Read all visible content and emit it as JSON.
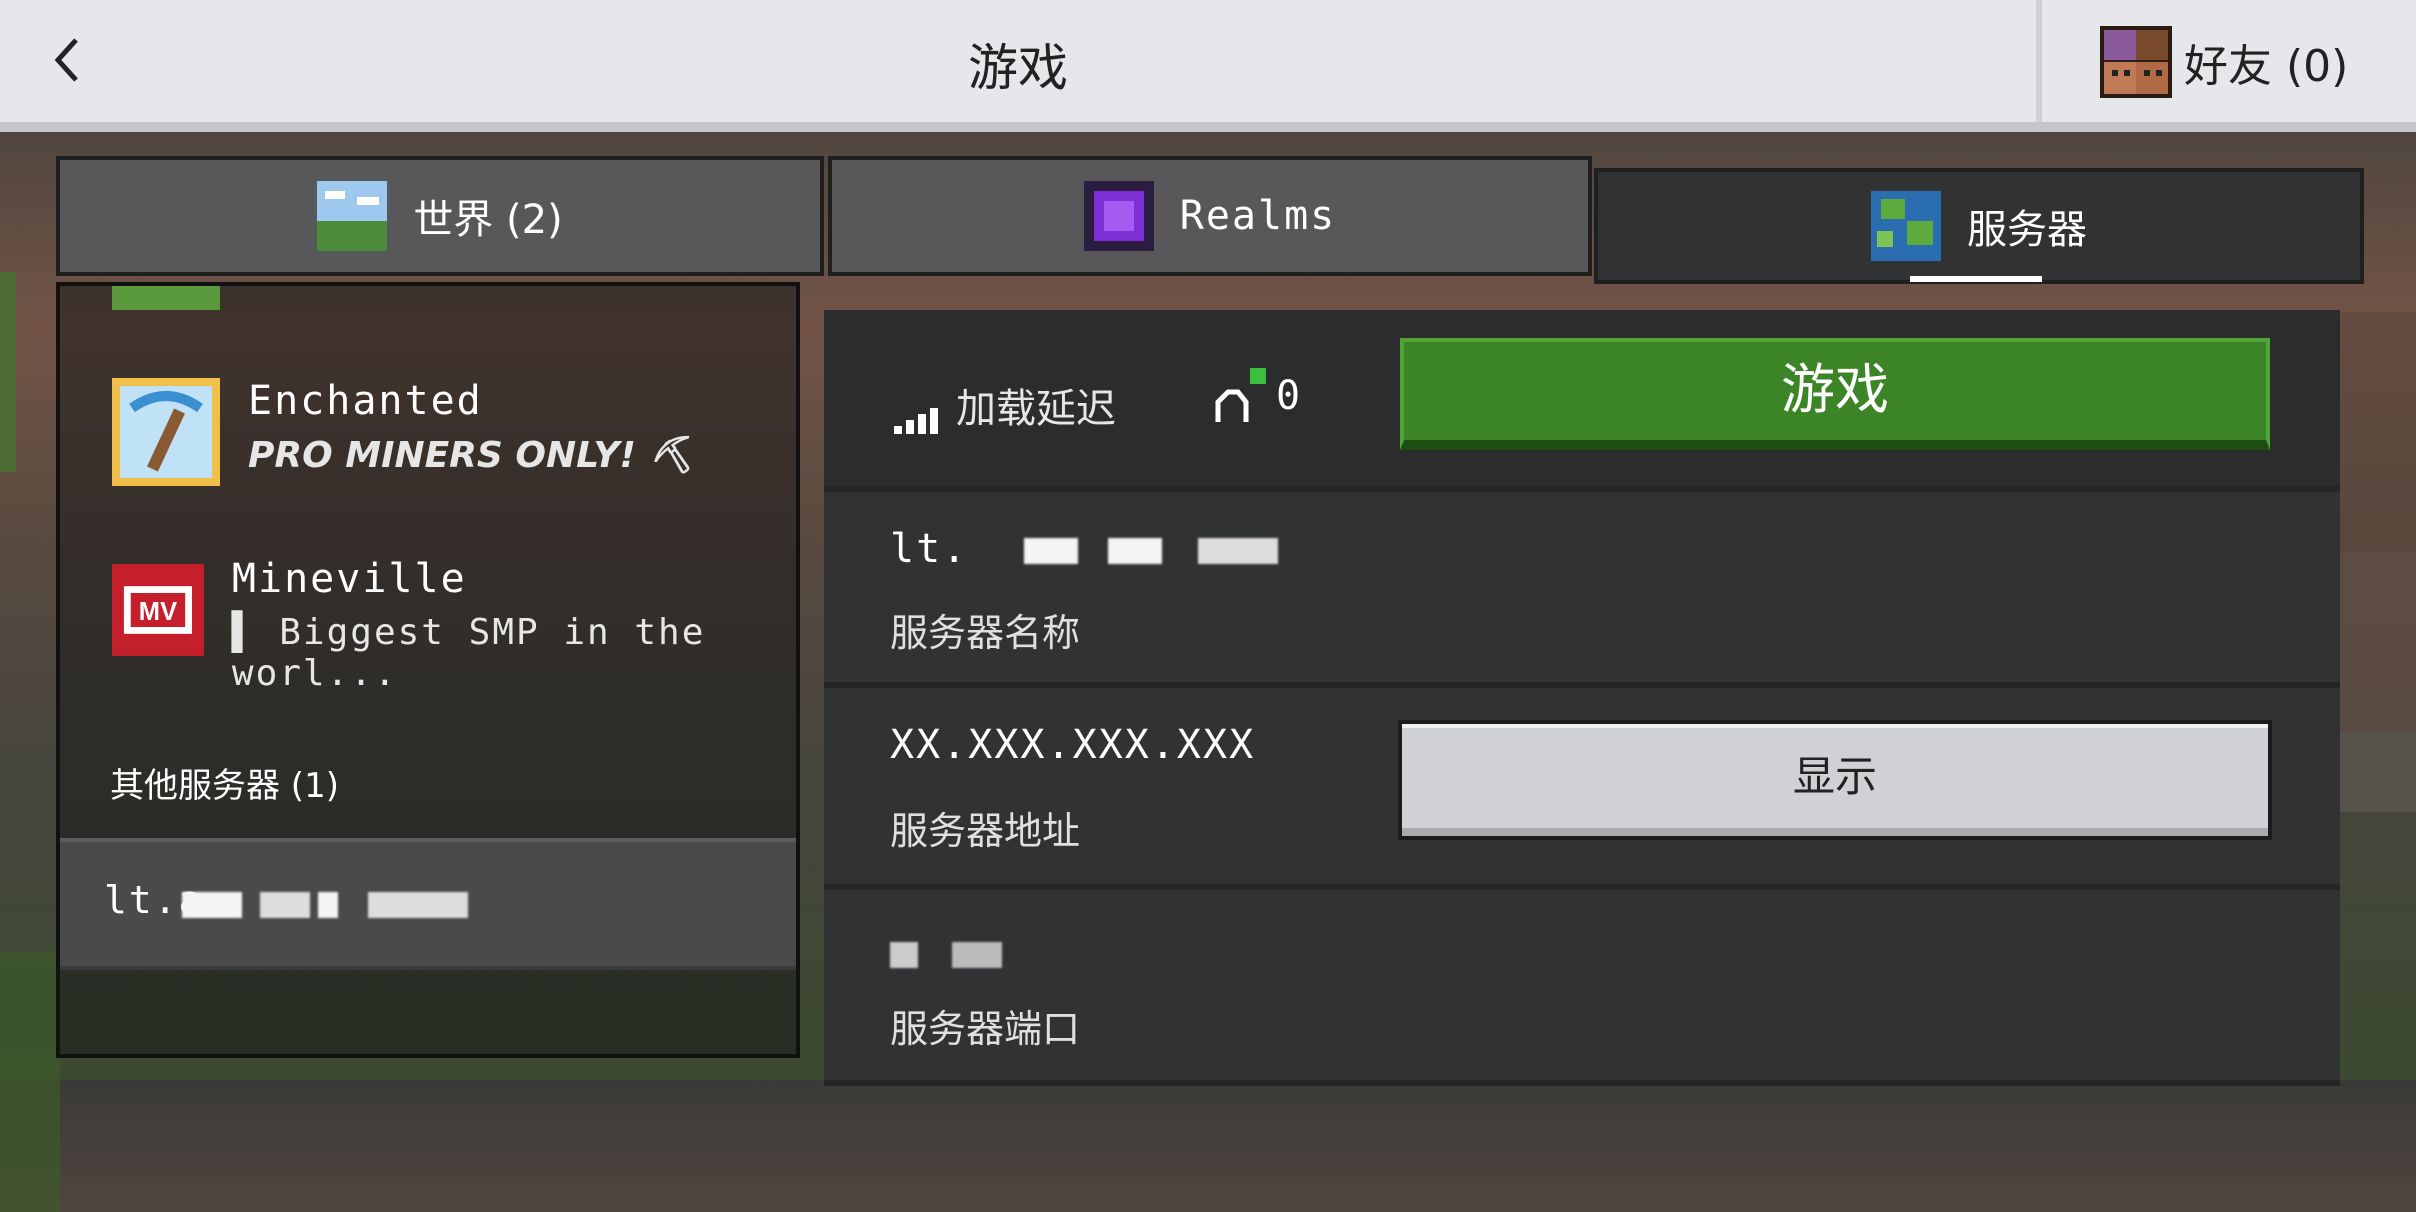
{
  "header": {
    "title": "游戏",
    "friends_label": "好友 (0)"
  },
  "tabs": [
    {
      "label": "世界 (2)",
      "icon": "world-icon"
    },
    {
      "label": "Realms",
      "icon": "realms-icon"
    },
    {
      "label": "服务器",
      "icon": "globe-icon",
      "active": true
    }
  ],
  "featured_servers": [
    {
      "name": "Enchanted",
      "motd": "PRO MINERS ONLY! ⛏",
      "icon": "enchanted-pickaxe-icon"
    },
    {
      "name": "Mineville",
      "motd": "▌ Biggest SMP in the worl...",
      "icon": "mineville-icon"
    }
  ],
  "other_servers": {
    "label": "其他服务器 (1)",
    "items": [
      {
        "name_prefix": "lt.a"
      }
    ]
  },
  "details": {
    "latency_label": "加载延迟",
    "player_count": "0",
    "play_label": "游戏",
    "server_name_value": "lt.",
    "server_name_label": "服务器名称",
    "server_address_value": "XX.XXX.XXX.XXX",
    "server_address_label": "服务器地址",
    "show_label": "显示",
    "server_port_label": "服务器端口"
  },
  "colors": {
    "play_green": "#3c8527",
    "panel": "#313233",
    "topbar": "#e6e7ea"
  }
}
